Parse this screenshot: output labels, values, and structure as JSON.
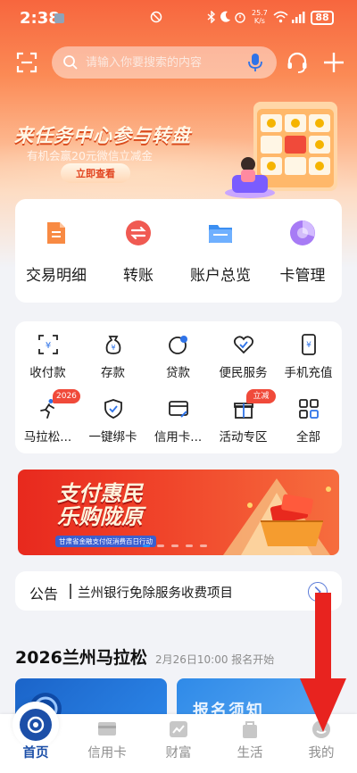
{
  "status_bar": {
    "time": "2:38",
    "speed_value": "25.7",
    "speed_unit": "K/s",
    "battery": "88",
    "icons": [
      "gallery-icon",
      "dnd-icon",
      "bluetooth-icon",
      "moon-icon",
      "wifi-icon",
      "signal-icon"
    ]
  },
  "search": {
    "placeholder": "请输入你要搜索的内容"
  },
  "promo": {
    "title": "来任务中心参与转盘",
    "subtitle": "有机会赢20元微信立减金",
    "button": "立即查看"
  },
  "quick_actions": [
    {
      "label": "交易明细",
      "icon": "transaction-detail-icon"
    },
    {
      "label": "转账",
      "icon": "transfer-icon"
    },
    {
      "label": "账户总览",
      "icon": "account-overview-icon"
    },
    {
      "label": "卡管理",
      "icon": "card-management-icon"
    }
  ],
  "services": [
    {
      "label": "收付款",
      "icon": "receive-pay-icon"
    },
    {
      "label": "存款",
      "icon": "deposit-icon"
    },
    {
      "label": "贷款",
      "icon": "loan-icon"
    },
    {
      "label": "便民服务",
      "icon": "convenience-service-icon"
    },
    {
      "label": "手机充值",
      "icon": "mobile-recharge-icon"
    },
    {
      "label": "马拉松...",
      "icon": "marathon-icon",
      "badge": "2026"
    },
    {
      "label": "一键绑卡",
      "icon": "bind-card-icon"
    },
    {
      "label": "信用卡...",
      "icon": "credit-card-icon"
    },
    {
      "label": "活动专区",
      "icon": "activity-zone-icon",
      "badge": "立减金"
    },
    {
      "label": "全部",
      "icon": "all-apps-icon"
    }
  ],
  "ad_banner": {
    "title_line1": "支付惠民",
    "title_line2": "乐购陇原",
    "subtitle": "甘肃省金融支付促消费百日行动"
  },
  "notice": {
    "tag": "公告",
    "text": "兰州银行免除服务收费项目"
  },
  "marathon": {
    "title": "2026兰州马拉松",
    "date_text": "2月26日10:00  报名开始",
    "tile2_text": "报名须知"
  },
  "tab_bar": [
    {
      "label": "首页",
      "active": true
    },
    {
      "label": "信用卡",
      "active": false
    },
    {
      "label": "财富",
      "active": false
    },
    {
      "label": "生活",
      "active": false
    },
    {
      "label": "我的",
      "active": false
    }
  ],
  "colors": {
    "brand_blue": "#1c4fa8",
    "hero_orange": "#f7663e",
    "annotation_red": "#e8231f"
  }
}
